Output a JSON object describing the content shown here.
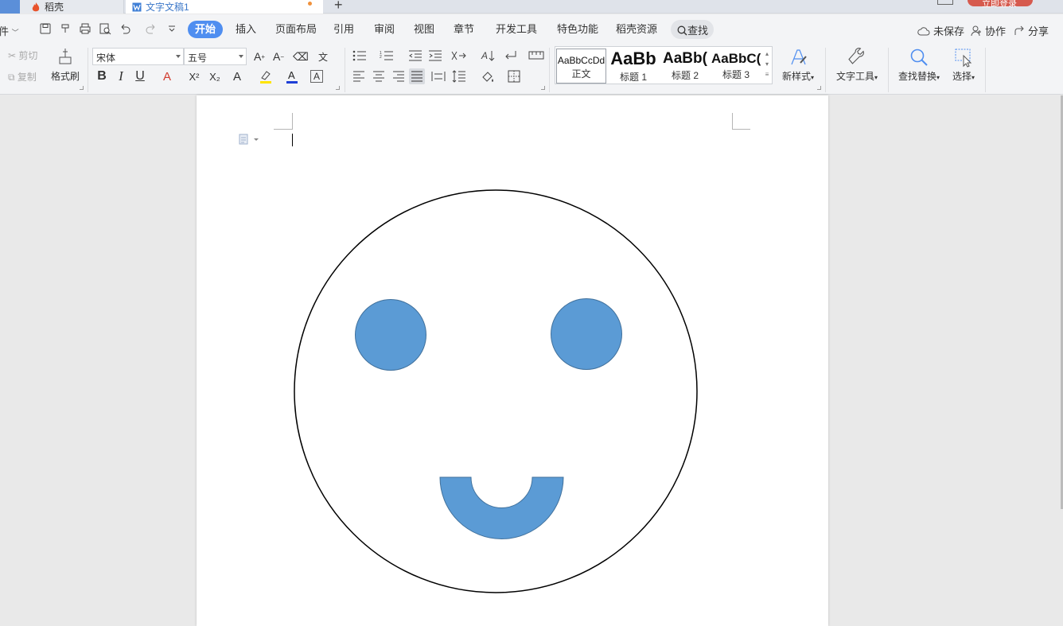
{
  "tabs": {
    "daoke": "稻壳",
    "document": "文字文稿1",
    "add": "+",
    "login": "立即登录"
  },
  "menu": {
    "file": "件",
    "active": "开始",
    "items": [
      "插入",
      "页面布局",
      "引用",
      "审阅",
      "视图",
      "章节",
      "开发工具",
      "特色功能",
      "稻壳资源"
    ],
    "search": "查找",
    "unsaved": "未保存",
    "collab": "协作",
    "share": "分享"
  },
  "ribbon": {
    "cut": "剪切",
    "copy": "复制",
    "format_painter": "格式刷",
    "font_name": "宋体",
    "font_size": "五号",
    "bold": "B",
    "italic": "I",
    "underline": "U",
    "superscript": "X²",
    "subscript": "X₂",
    "styles": [
      {
        "sample": "AaBbCcDd",
        "name": "正文"
      },
      {
        "sample": "AaBb",
        "name": "标题 1"
      },
      {
        "sample": "AaBb(",
        "name": "标题 2"
      },
      {
        "sample": "AaBbC(",
        "name": "标题 3"
      }
    ],
    "new_style": "新样式",
    "text_tools": "文字工具",
    "find_replace": "查找替换",
    "select": "选择"
  },
  "colors": {
    "accent": "#4f8ef0",
    "shape_fill": "#5b9bd5",
    "shape_stroke": "#41719c",
    "font_color_bar": "#1f3fd6",
    "highlight_bar": "#ffe400",
    "text_effect_bar": "#d23b2e"
  }
}
